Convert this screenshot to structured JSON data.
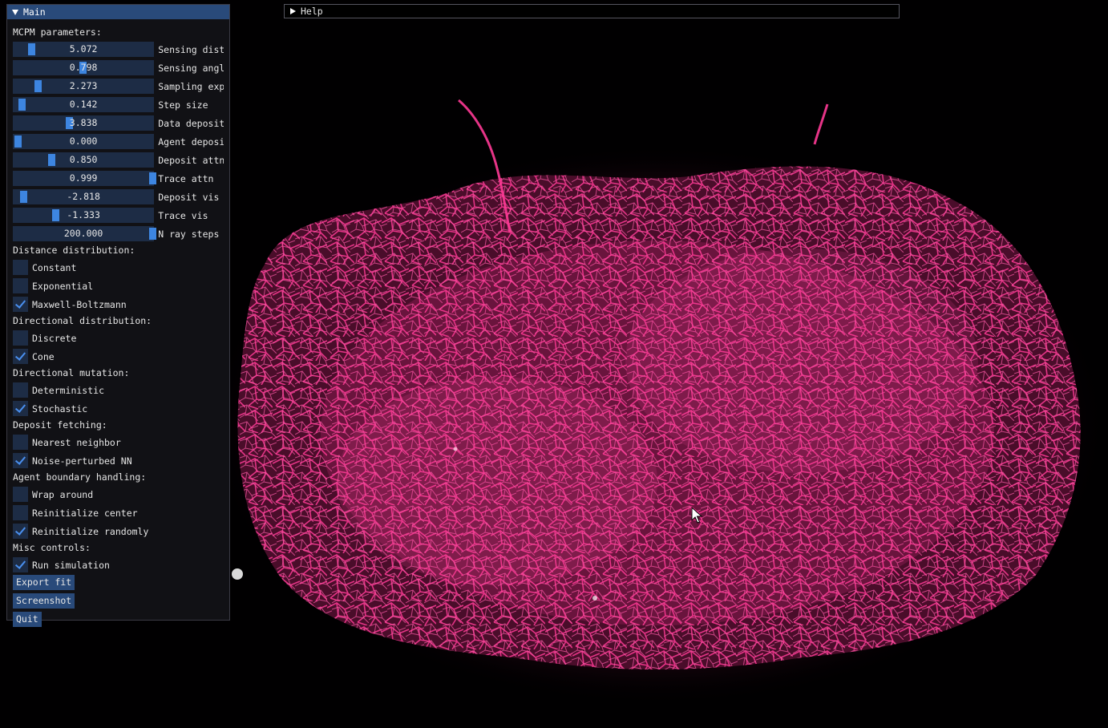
{
  "main_window": {
    "title": "Main",
    "sections": {
      "mcpm": "MCPM parameters:",
      "distance": "Distance distribution:",
      "directional": "Directional distribution:",
      "mutation": "Directional mutation:",
      "fetching": "Deposit fetching:",
      "boundary": "Agent boundary handling:",
      "misc": "Misc controls:"
    },
    "sliders": [
      {
        "label": "Sensing dist",
        "value": "5.072",
        "fill": 0.1
      },
      {
        "label": "Sensing angl",
        "value": "0.798",
        "fill": 0.48
      },
      {
        "label": "Sampling exp",
        "value": "2.273",
        "fill": 0.15
      },
      {
        "label": "Step size",
        "value": "0.142",
        "fill": 0.03
      },
      {
        "label": "Data deposit",
        "value": "3.838",
        "fill": 0.38
      },
      {
        "label": "Agent deposi",
        "value": "0.000",
        "fill": 0.0
      },
      {
        "label": "Deposit attn",
        "value": "0.850",
        "fill": 0.25
      },
      {
        "label": "Trace attn",
        "value": "0.999",
        "fill": 1.0
      },
      {
        "label": "Deposit vis",
        "value": "-2.818",
        "fill": 0.04
      },
      {
        "label": "Trace vis",
        "value": "-1.333",
        "fill": 0.28
      },
      {
        "label": "N ray steps",
        "value": "200.000",
        "fill": 1.0
      }
    ],
    "distance_options": [
      {
        "label": "Constant",
        "checked": false
      },
      {
        "label": "Exponential",
        "checked": false
      },
      {
        "label": "Maxwell-Boltzmann",
        "checked": true
      }
    ],
    "directional_options": [
      {
        "label": "Discrete",
        "checked": false
      },
      {
        "label": "Cone",
        "checked": true
      }
    ],
    "mutation_options": [
      {
        "label": "Deterministic",
        "checked": false
      },
      {
        "label": "Stochastic",
        "checked": true
      }
    ],
    "fetching_options": [
      {
        "label": "Nearest neighbor",
        "checked": false
      },
      {
        "label": "Noise-perturbed NN",
        "checked": true
      }
    ],
    "boundary_options": [
      {
        "label": "Wrap around",
        "checked": false
      },
      {
        "label": "Reinitialize center",
        "checked": false
      },
      {
        "label": "Reinitialize randomly",
        "checked": true
      }
    ],
    "misc_options": [
      {
        "label": "Run simulation",
        "checked": true
      }
    ],
    "buttons": {
      "export": "Export fit",
      "screenshot": "Screenshot",
      "quit": "Quit"
    }
  },
  "help_window": {
    "title": "Help"
  },
  "colors": {
    "filament": "#ff3a96",
    "panel_bg": "#121216",
    "title_bg": "#294a7a",
    "frame_bg": "#1d2c45",
    "grab": "#3d85e0"
  },
  "icons": {
    "collapse": "triangle-down-icon",
    "expand": "triangle-right-icon",
    "cursor": "mouse-pointer-icon"
  }
}
